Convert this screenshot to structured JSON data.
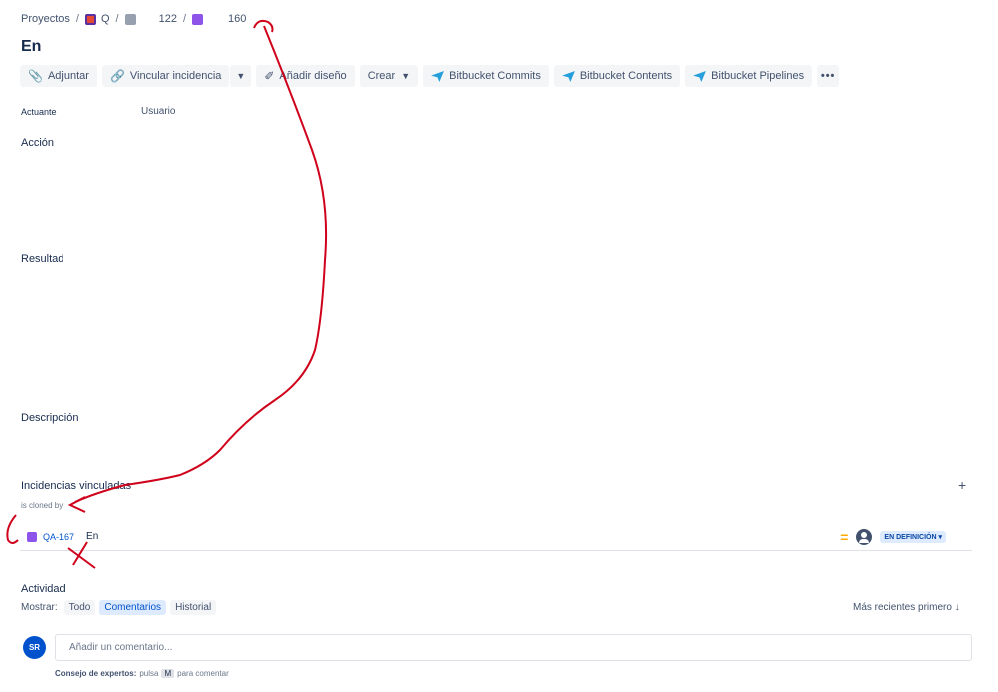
{
  "breadcrumb": {
    "root": "Proyectos",
    "project": "Q",
    "parent": "122",
    "issue": "160"
  },
  "issue": {
    "title": "En"
  },
  "toolbar": {
    "attach": "Adjuntar",
    "link": "Vincular incidencia",
    "design": "Añadir diseño",
    "create": "Crear",
    "bb_commits": "Bitbucket Commits",
    "bb_contents": "Bitbucket Contents",
    "bb_pipelines": "Bitbucket Pipelines",
    "more": "•••"
  },
  "fields": {
    "actor_label": "Actuante",
    "actor_value": "Usuario",
    "action": "Acción",
    "result": "Resultado",
    "description": "Descripción"
  },
  "linked": {
    "title": "Incidencias vinculadas",
    "add": "+",
    "relation": "is cloned by",
    "item": {
      "key": "QA-167",
      "summary": "En",
      "priority": "=",
      "status": "EN DEFINICIÓN ▾"
    }
  },
  "activity": {
    "title": "Actividad",
    "show_label": "Mostrar:",
    "filters": [
      "Todo",
      "Comentarios",
      "Historial"
    ],
    "sort": "Más recientes primero ↓",
    "avatar": "SR",
    "comment_placeholder": "Añadir un comentario...",
    "tip_bold": "Consejo de expertos:",
    "tip_pre": "pulsa",
    "tip_key": "M",
    "tip_post": "para comentar"
  },
  "colors": {
    "annotation": "#d0021b",
    "accent": "#0052cc",
    "story": "#8e54e9"
  }
}
